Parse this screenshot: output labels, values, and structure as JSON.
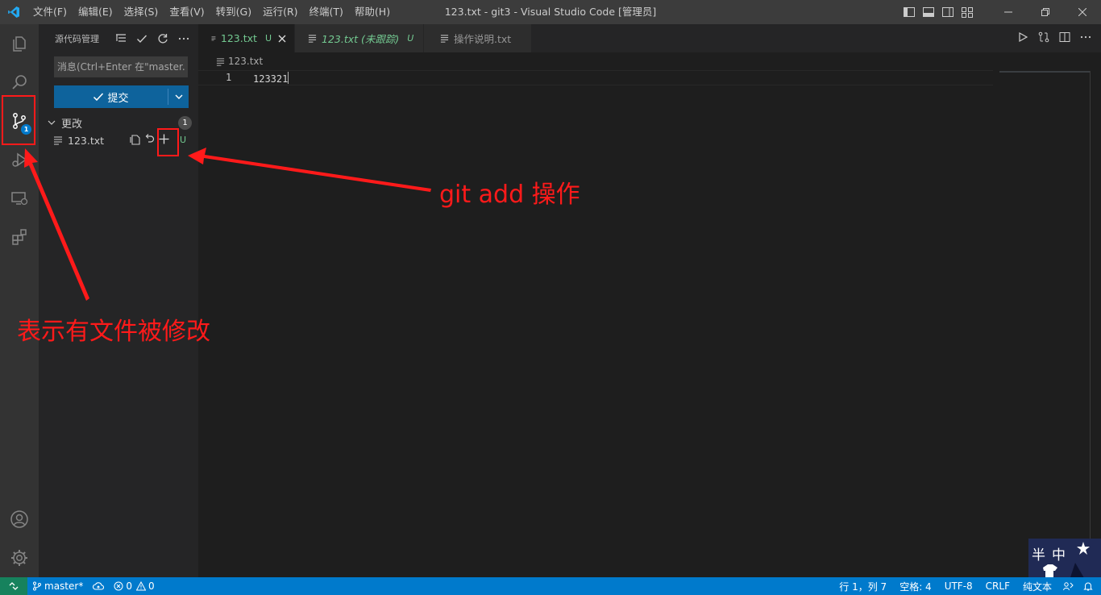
{
  "titlebar": {
    "menu": [
      "文件(F)",
      "编辑(E)",
      "选择(S)",
      "查看(V)",
      "转到(G)",
      "运行(R)",
      "终端(T)",
      "帮助(H)"
    ],
    "title": "123.txt - git3 - Visual Studio Code [管理员]"
  },
  "activitybar": {
    "icons": [
      "explorer-icon",
      "search-icon",
      "source-control-icon",
      "run-debug-icon",
      "remote-explorer-icon",
      "extensions-icon",
      "account-icon",
      "settings-gear-icon"
    ],
    "scm_badge": "1"
  },
  "sidebar": {
    "title": "源代码管理",
    "message_placeholder": "消息(Ctrl+Enter 在\"master...",
    "commit_label": "提交",
    "changes_label": "更改",
    "changes_count": "1",
    "file_name": "123.txt",
    "file_status": "U"
  },
  "tabs": [
    {
      "label": "123.txt",
      "status": "U"
    },
    {
      "label": "123.txt (未跟踪)",
      "status": "U"
    },
    {
      "label": "操作说明.txt",
      "status": ""
    }
  ],
  "editor": {
    "breadcrumb": "123.txt",
    "line_number": "1",
    "line_text": "123321"
  },
  "annotations": {
    "git_add": "git add 操作",
    "modified": "表示有文件被修改"
  },
  "watermark": {
    "text": "半中"
  },
  "statusbar": {
    "branch": "master*",
    "errors": "0",
    "warnings": "0",
    "cursor_pos": "行 1，列 7",
    "indent": "空格: 4",
    "encoding": "UTF-8",
    "eol": "CRLF",
    "language": "纯文本"
  },
  "colors": {
    "accent": "#007acc",
    "annotation": "#ff1a1a",
    "untracked": "#73c991"
  }
}
